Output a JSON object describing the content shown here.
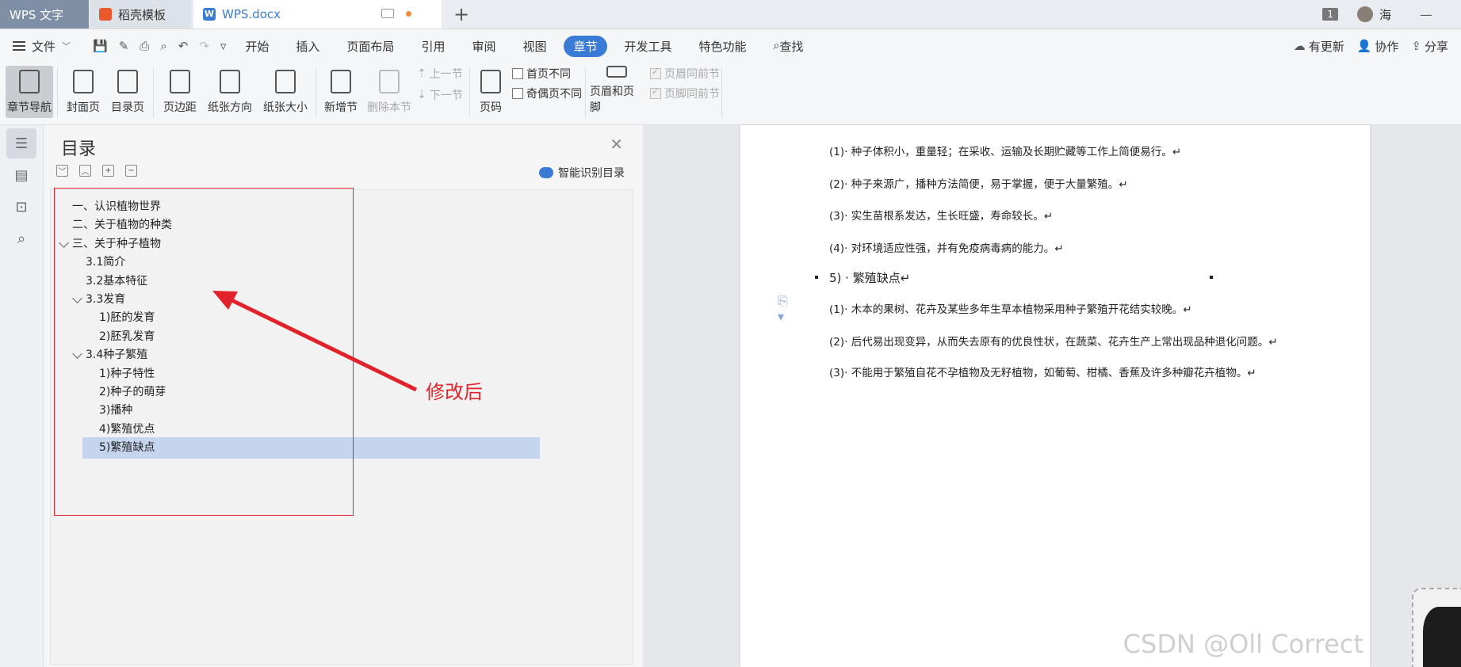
{
  "tabs": {
    "app": "WPS 文字",
    "docer": "稻壳模板",
    "doc": "WPS.docx",
    "new_tab": "+"
  },
  "titlebar": {
    "window_count": "1",
    "user": "海",
    "minimize": "—"
  },
  "menu": {
    "file": "文件",
    "tabs": [
      "开始",
      "插入",
      "页面布局",
      "引用",
      "审阅",
      "视图",
      "章节",
      "开发工具",
      "特色功能",
      "查找"
    ],
    "active_tab": "章节",
    "right": {
      "update": "有更新",
      "collab": "协作",
      "share": "分享"
    }
  },
  "ribbon": {
    "section_nav": "章节导航",
    "cover": "封面页",
    "toc_page": "目录页",
    "margin": "页边距",
    "orientation": "纸张方向",
    "size": "纸张大小",
    "new_section": "新增节",
    "delete_section": "删除本节",
    "prev_section": "上一节",
    "next_section": "下一节",
    "page_number": "页码",
    "first_diff": "首页不同",
    "odd_even_diff": "奇偶页不同",
    "header_footer": "页眉和页脚",
    "header_same": "页眉同前节",
    "footer_same": "页脚同前节"
  },
  "toc": {
    "title": "目录",
    "smart_label": "智能识别目录",
    "items": [
      {
        "label": "一、认识植物世界",
        "level": 1
      },
      {
        "label": "二、关于植物的种类",
        "level": 1
      },
      {
        "label": "三、关于种子植物",
        "level": 1,
        "expanded": true
      },
      {
        "label": "3.1简介",
        "level": 2
      },
      {
        "label": "3.2基本特征",
        "level": 2
      },
      {
        "label": "3.3发育",
        "level": 2,
        "expanded": true
      },
      {
        "label": "1)胚的发育",
        "level": 3
      },
      {
        "label": "2)胚乳发育",
        "level": 3
      },
      {
        "label": "3.4种子繁殖",
        "level": 2,
        "expanded": true
      },
      {
        "label": "1)种子特性",
        "level": 3
      },
      {
        "label": "2)种子的萌芽",
        "level": 3
      },
      {
        "label": "3)播种",
        "level": 3
      },
      {
        "label": "4)繁殖优点",
        "level": 3
      },
      {
        "label": "5)繁殖缺点",
        "level": 3,
        "selected": true
      }
    ]
  },
  "annotation": {
    "text": "修改后",
    "color": "#e2222a"
  },
  "document": {
    "paragraphs": [
      "(1)· 种子体积小，重量轻；在采收、运输及长期贮藏等工作上简便易行。↵",
      "(2)· 种子来源广，播种方法简便，易于掌握，便于大量繁殖。↵",
      "(3)· 实生苗根系发达，生长旺盛，寿命较长。↵",
      "(4)· 对环境适应性强，并有免疫病毒病的能力。↵",
      "5) · 繁殖缺点↵",
      "(1)· 木本的果树、花卉及某些多年生草本植物采用种子繁殖开花结实较晚。↵",
      "(2)· 后代易出现变异，从而失去原有的优良性状，在蔬菜、花卉生产上常出现品种退化问题。↵",
      "(3)· 不能用于繁殖自花不孕植物及无籽植物，如葡萄、柑橘、香蕉及许多种瓣花卉植物。↵"
    ],
    "watermark": "CSDN @Oll Correct"
  },
  "colors": {
    "accent": "#3a7bd5",
    "selection": "#c5d5ee",
    "annotation_red": "#e2222a"
  }
}
